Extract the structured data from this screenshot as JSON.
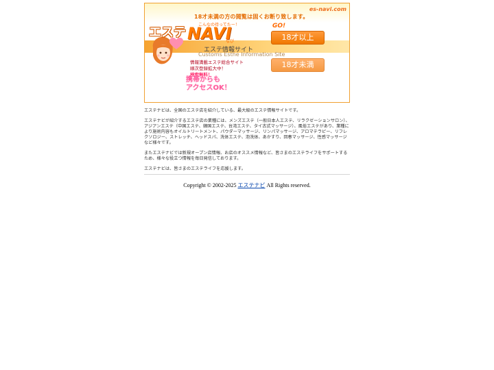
{
  "banner": {
    "warning_text": "18才未満の方の閲覧は固くお断り致します。",
    "domain_text": "es-navi.com",
    "logo_part1": "エステ",
    "logo_part2": "NAVI",
    "catchphrase": "こんなの待ってたー！",
    "tag_text": "なび",
    "subtitle_jp": "エステ情報サイト",
    "subtitle_en": "Customs Esthe Information Site",
    "line1": "情報満載エステ総合サイト",
    "line2": "順次登録拡大中！",
    "line3": "検索無料！",
    "mobile_text": "携帯からも\nアクセスOK！",
    "go_label": "GO!",
    "btn_18plus": "18才以上",
    "btn_under18": "18才未満",
    "colors": {
      "accent": "#ff7a00",
      "border": "#f0a030",
      "button_primary": "#f07800",
      "button_secondary": "#f59a43"
    }
  },
  "content": {
    "paragraphs": [
      "エステナビは、全国のエステ店を紹介している、最大級のエステ情報サイトです。",
      "エステナビが紹介するエステ店の業種には、メンズエステ（一般日本人エステ、リラクゼーションサロン）、アジアンエステ（中国エステ、韓国エステ、台湾エステ、タイ古式マッサージ）、風俗エステがあり、業種により施術内容もオイルトリートメント、パウダーマッサージ、リンパマッサージ、アロマテラピー、リフレクソロジー、ストレッチ、ヘッドスパ、洗体エステ、泡洗体、あかすり、回春マッサージ、性感マッサージなど様々です。",
      "またエステナビでは新規オープン店情報、お店のオススメ情報など、皆さまのエステライフをサポートするため、様々な役立つ情報を毎日発信しております。",
      "エステナビは、皆さまのエステライフを応援します。"
    ]
  },
  "footer": {
    "prefix": "Copyright © 2002-2025 ",
    "link_text": "エステナビ",
    "suffix": " All Rights reserved."
  }
}
